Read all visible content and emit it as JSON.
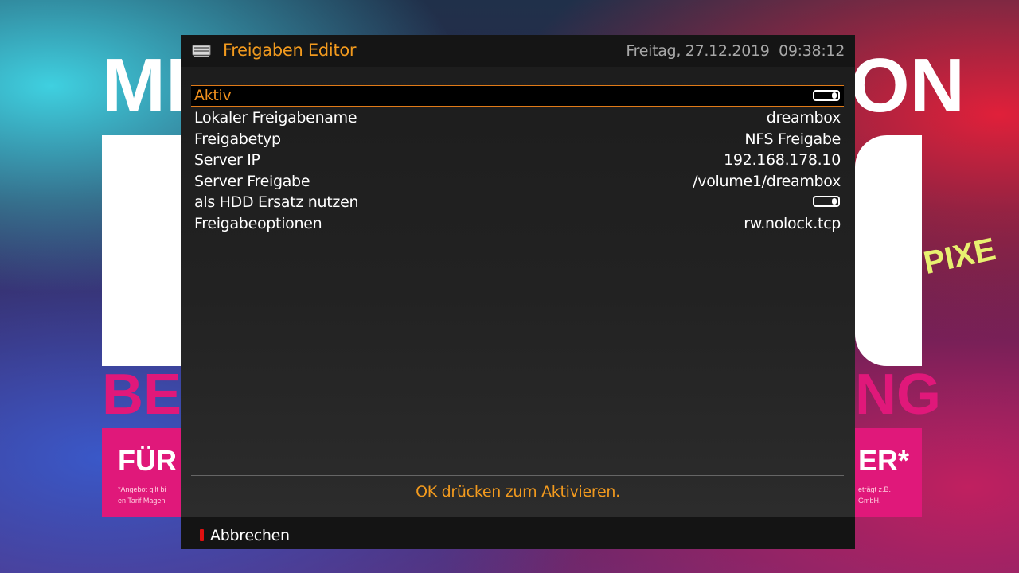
{
  "header": {
    "title": "Freigaben Editor",
    "datetime": "Freitag, 27.12.2019  09:38:12",
    "icon": "network-drive-icon"
  },
  "settings": [
    {
      "label": "Aktiv",
      "type": "toggle",
      "enabled": true,
      "selected": true
    },
    {
      "label": "Lokaler Freigabename",
      "type": "text",
      "value": "dreambox"
    },
    {
      "label": "Freigabetyp",
      "type": "text",
      "value": "NFS Freigabe"
    },
    {
      "label": "Server IP",
      "type": "text",
      "value": "192.168.178.10"
    },
    {
      "label": "Server Freigabe",
      "type": "text",
      "value": "/volume1/dreambox"
    },
    {
      "label": "als HDD Ersatz nutzen",
      "type": "toggle",
      "enabled": true
    },
    {
      "label": "Freigabeoptionen",
      "type": "text",
      "value": "rw.nolock.tcp"
    }
  ],
  "hint": "OK drücken zum Aktivieren.",
  "footer": {
    "red_button_label": "Abbrechen",
    "red_key_color": "#e01010"
  },
  "colors": {
    "accent": "#f29a1e",
    "selection_border": "#e07a18",
    "panel_bg": "#1d1d1d"
  },
  "background": {
    "big_letters_top_left": "ME",
    "big_letters_top_right": "ON",
    "pink_left": "BE",
    "pink_right": "NG",
    "box_left_text": "FÜR",
    "box_right_text": "ER*",
    "small_left": "*Angebot gilt bi",
    "small_left_2": "en Tarif Magen",
    "small_right": "eträgt z.B.",
    "small_right_2": "GmbH.",
    "side_text": "PIXE"
  }
}
